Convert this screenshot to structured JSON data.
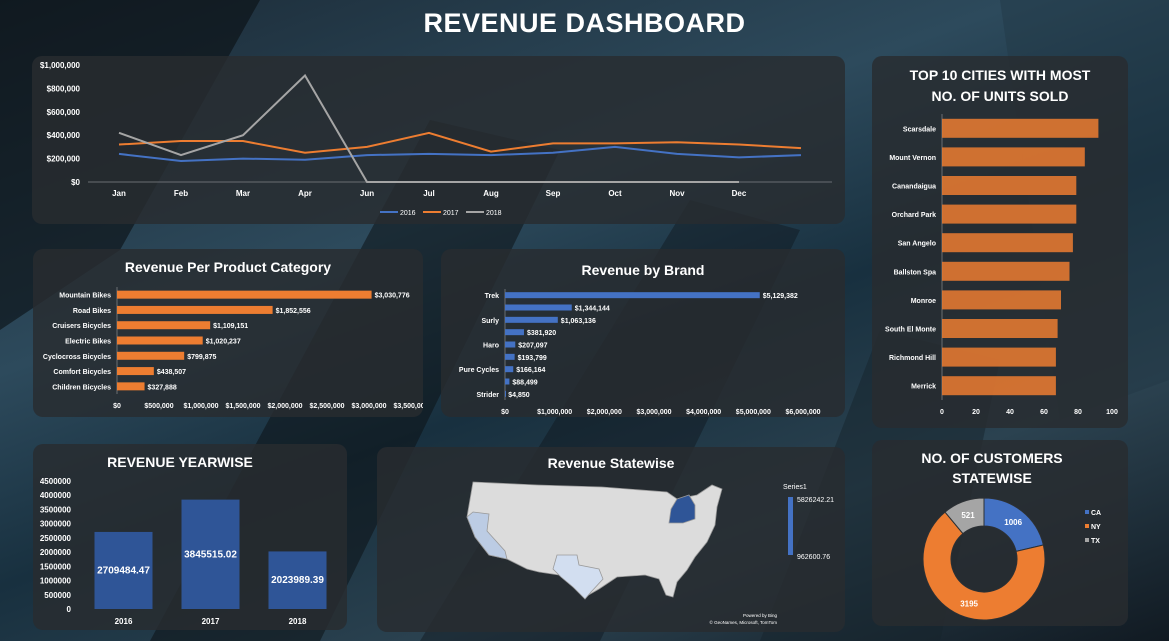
{
  "header": {
    "title": "REVENUE DASHBOARD"
  },
  "colors": {
    "y2016": "#4472c4",
    "y2017": "#ed7d31",
    "y2018": "#a5a5a5",
    "bar_orange": "#ed7d31",
    "bar_blue": "#4472c4",
    "panel": "#2c3034"
  },
  "chart_data": [
    {
      "id": "monthly",
      "type": "line",
      "title": "",
      "categories": [
        "Jan",
        "Feb",
        "Mar",
        "Apr",
        "Jun",
        "Jul",
        "Aug",
        "Sep",
        "Oct",
        "Nov",
        "Dec"
      ],
      "y_ticks": [
        "$0",
        "$200,000",
        "$400,000",
        "$600,000",
        "$800,000",
        "$1,000,000"
      ],
      "ylim": [
        0,
        1000000
      ],
      "series": [
        {
          "name": "2016",
          "values": [
            240000,
            180000,
            200000,
            190000,
            230000,
            240000,
            230000,
            250000,
            300000,
            240000,
            210000,
            230000
          ]
        },
        {
          "name": "2017",
          "values": [
            320000,
            350000,
            350000,
            250000,
            300000,
            420000,
            260000,
            330000,
            330000,
            340000,
            320000,
            290000
          ]
        },
        {
          "name": "2018",
          "values": [
            420000,
            230000,
            400000,
            910000,
            0,
            0,
            0,
            0,
            0,
            0,
            0,
            null
          ]
        }
      ],
      "legend": [
        "2016",
        "2017",
        "2018"
      ],
      "legend_position": "bottom"
    },
    {
      "id": "category",
      "type": "bar",
      "title": "Revenue Per Product Category",
      "categories": [
        "Mountain Bikes",
        "Road Bikes",
        "Cruisers Bicycles",
        "Electric Bikes",
        "Cyclocross Bicycles",
        "Comfort Bicycles",
        "Children Bicycles"
      ],
      "values": [
        3030776,
        1852556,
        1109151,
        1020237,
        799875,
        438507,
        327888
      ],
      "labels": [
        "$3,030,776",
        "$1,852,556",
        "$1,109,151",
        "$1,020,237",
        "$799,875",
        "$438,507",
        "$327,888"
      ],
      "x_ticks": [
        "$0",
        "$500,000",
        "$1,000,000",
        "$1,500,000",
        "$2,000,000",
        "$2,500,000",
        "$3,000,000",
        "$3,500,000"
      ],
      "xlim": [
        0,
        3500000
      ]
    },
    {
      "id": "brand",
      "type": "bar",
      "title": "Revenue by Brand",
      "categories": [
        "Trek",
        "",
        "Surly",
        "",
        "Haro",
        "",
        "Pure Cycles",
        "",
        "Strider"
      ],
      "values": [
        5129382,
        1344144,
        1063136,
        381920,
        207097,
        193799,
        166164,
        88499,
        4850
      ],
      "labels": [
        "$5,129,382",
        "$1,344,144",
        "$1,063,136",
        "$381,920",
        "$207,097",
        "$193,799",
        "$166,164",
        "$88,499",
        "$4,850"
      ],
      "x_ticks": [
        "$0",
        "$1,000,000",
        "$2,000,000",
        "$3,000,000",
        "$4,000,000",
        "$5,000,000",
        "$6,000,000"
      ],
      "xlim": [
        0,
        6000000
      ]
    },
    {
      "id": "cities",
      "type": "bar",
      "title": "TOP 10 CITIES WITH MOST NO. OF UNITS SOLD",
      "title_lines": [
        "TOP 10 CITIES WITH MOST",
        "NO. OF UNITS SOLD"
      ],
      "categories": [
        "Scarsdale",
        "Mount Vernon",
        "Canandaigua",
        "Orchard Park",
        "San Angelo",
        "Ballston Spa",
        "Monroe",
        "South El Monte",
        "Richmond Hill",
        "Merrick"
      ],
      "values": [
        92,
        84,
        79,
        79,
        77,
        75,
        70,
        68,
        67,
        67
      ],
      "x_ticks": [
        "0",
        "20",
        "40",
        "60",
        "80",
        "100"
      ],
      "xlim": [
        0,
        100
      ]
    },
    {
      "id": "yearwise",
      "type": "bar",
      "title": "REVENUE YEARWISE",
      "categories": [
        "2016",
        "2017",
        "2018"
      ],
      "values": [
        2709484.47,
        3845515.02,
        2023989.39
      ],
      "labels": [
        "2709484.47",
        "3845515.02",
        "2023989.39"
      ],
      "y_ticks": [
        "0",
        "500000",
        "1000000",
        "1500000",
        "2000000",
        "2500000",
        "3000000",
        "3500000",
        "4000000",
        "4500000"
      ],
      "ylim": [
        0,
        4500000
      ]
    },
    {
      "id": "statewise",
      "type": "heatmap",
      "title": "Revenue Statewise",
      "legend_title": "Series1",
      "legend_max": "5826242.21",
      "legend_min": "962600.76",
      "states": [
        {
          "name": "NY",
          "value": 5826242.21
        },
        {
          "name": "CA",
          "value": 1605823.04
        },
        {
          "name": "TX",
          "value": 962600.76
        }
      ],
      "credits": [
        "Powered by Bing",
        "© GeoNames, Microsoft, TomTom"
      ]
    },
    {
      "id": "customers",
      "type": "pie",
      "title": "NO. OF CUSTOMERS STATEWISE",
      "title_lines": [
        "NO. OF CUSTOMERS",
        "STATEWISE"
      ],
      "categories": [
        "CA",
        "NY",
        "TX"
      ],
      "values": [
        1006,
        3195,
        521
      ],
      "labels": [
        "1006",
        "3195",
        "521"
      ],
      "legend_position": "right"
    }
  ]
}
